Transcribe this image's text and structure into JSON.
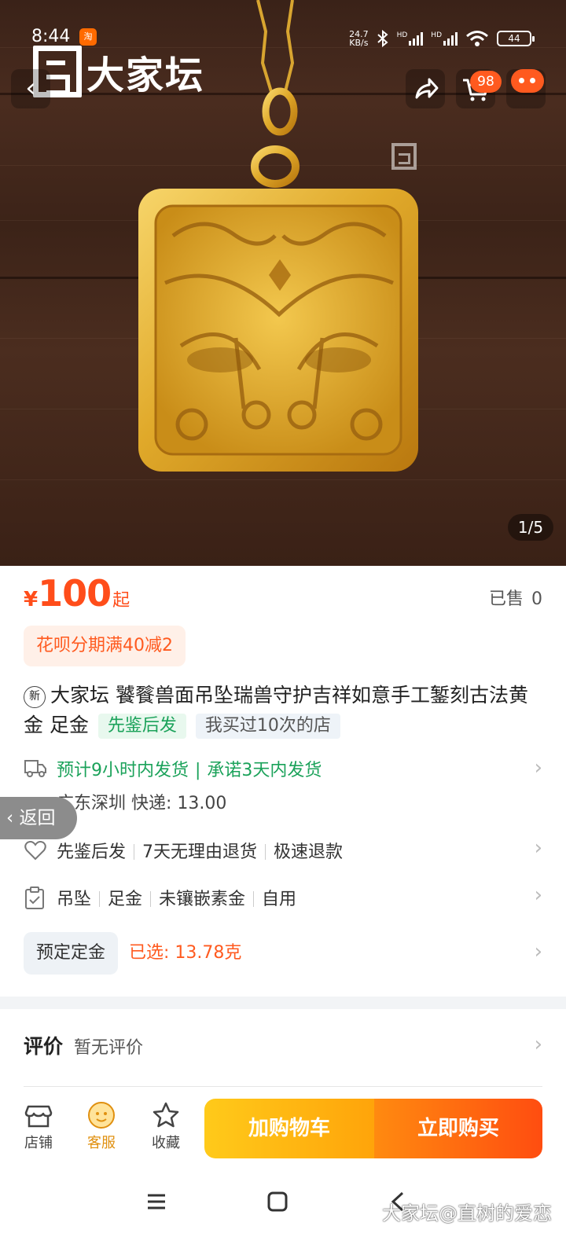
{
  "status_bar": {
    "time": "8:44",
    "app_badge": "淘",
    "net_speed_value": "24.7",
    "net_speed_unit": "KB/s",
    "hd1": "HD",
    "hd2": "HD",
    "battery": "44"
  },
  "header": {
    "logo_text": "大家坛",
    "cart_count": "98"
  },
  "gallery": {
    "counter": "1/5"
  },
  "product": {
    "price_currency": "¥",
    "price_value": "100",
    "price_suffix": "起",
    "sold_label": "已售",
    "sold_count": "0",
    "promo": "花呗分期满40减2",
    "new_tag": "新",
    "title": "大家坛 饕餮兽面吊坠瑞兽守护吉祥如意手工錾刻古法黄金 足金",
    "tag_verify": "先鉴后发",
    "tag_repeat": "我买过10次的店"
  },
  "shipping": {
    "line1_a": "预计9小时内发货",
    "line1_b": "承诺3天内发货",
    "line2": "广东深圳  快递: 13.00"
  },
  "return_pill": "返回",
  "services": [
    "先鉴后发",
    "7天无理由退货",
    "极速退款"
  ],
  "attributes": [
    "吊坠",
    "足金",
    "未镶嵌素金",
    "自用"
  ],
  "spec": {
    "chip": "预定定金",
    "selected": "已选: 13.78克"
  },
  "review": {
    "label": "评价",
    "value": "暂无评价"
  },
  "bottom_nav": {
    "shop": "店铺",
    "service": "客服",
    "favorite": "收藏",
    "add_cart": "加购物车",
    "buy_now": "立即购买"
  },
  "credit": "大家坛@直树的爱恋",
  "colors": {
    "accent": "#ff4d1a",
    "green": "#1ba25a",
    "cart_btn": "#ffb310",
    "buy_btn": "#ff5a10"
  }
}
